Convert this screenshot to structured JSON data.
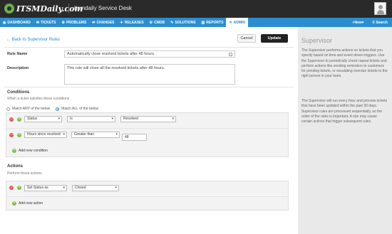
{
  "app": {
    "brand": "ITSMDaily.com",
    "title": "Itsmdaily Service Desk"
  },
  "nav": {
    "items": [
      {
        "label": "DASHBOARD",
        "icon": "dashboard-icon",
        "glyph": "◉"
      },
      {
        "label": "TICKETS",
        "icon": "tickets-icon",
        "glyph": "✉"
      },
      {
        "label": "PROBLEMS",
        "icon": "problems-icon",
        "glyph": "☢"
      },
      {
        "label": "CHANGES",
        "icon": "changes-icon",
        "glyph": "⇄"
      },
      {
        "label": "RELEASES",
        "icon": "releases-icon",
        "glyph": "✈"
      },
      {
        "label": "CMDB",
        "icon": "cmdb-icon",
        "glyph": "⚙"
      },
      {
        "label": "SOLUTIONS",
        "icon": "solutions-icon",
        "glyph": "✎"
      },
      {
        "label": "REPORTS",
        "icon": "reports-icon",
        "glyph": "▥"
      },
      {
        "label": "ADMIN",
        "icon": "admin-icon",
        "glyph": "✕"
      }
    ],
    "new_label": "New",
    "search_label": "Search"
  },
  "page": {
    "back_label": "Back to Supervisor Rules",
    "cancel_label": "Cancel",
    "update_label": "Update"
  },
  "form": {
    "rule_name_label": "Rule Name",
    "rule_name_value": "Automatically close resolved tickets after 48 hours",
    "description_label": "Description",
    "description_value": "This rule will close all the resolved tickets after 48 hours."
  },
  "conditions": {
    "title": "Conditions",
    "subtitle": "When a ticket satisfies these conditions",
    "match_any_label": "Match ANY of the below",
    "match_all_label": "Match ALL of the below",
    "selected": "all",
    "rows": [
      {
        "field": "Status",
        "operator": "Is",
        "value": "Resolved"
      },
      {
        "field": "Hours since resolved",
        "operator": "Greater than",
        "value": "48"
      }
    ],
    "add_label": "Add new condition"
  },
  "actions": {
    "title": "Actions",
    "subtitle": "Perform these actions",
    "rows": [
      {
        "action": "Set Status as",
        "value": "Closed"
      }
    ],
    "add_label": "Add new action"
  },
  "sidebar": {
    "title": "Supervisor",
    "paragraphs": [
      "The Supervisor performs actions on tickets that you specify based on time and event driven triggers. Use the Supervisor to periodically check repeat tickets and perform actions like sending reminders to customers for pending tickets, or escalating overdue tickets to the right person in your team.",
      "The Supervisor will run every hour and process tickets that have been updated within the past 30 days. Supervisor rules are processed sequentially, so the order of the rules is important. A rule may cause certain actions that trigger subsequent rules."
    ]
  },
  "colors": {
    "brand_blue": "#2c8ed1",
    "remove_red": "#e05b4b",
    "add_green": "#7bc043"
  }
}
